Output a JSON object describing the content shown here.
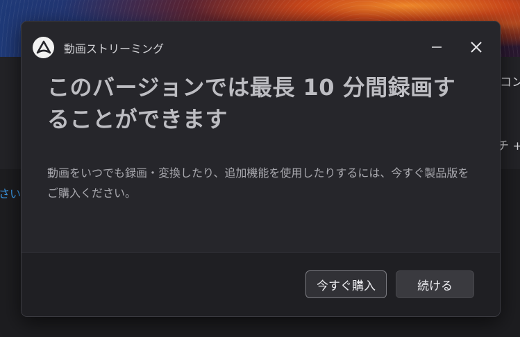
{
  "background": {
    "side_text_1": "コンテ",
    "side_text_2": "チ +",
    "link_text": "さい。"
  },
  "dialog": {
    "app_name": "動画ストリーミング",
    "logo_icon": "app-logo-icon",
    "minimize_icon": "minimize-icon",
    "close_icon": "close-icon",
    "headline": "このバージョンでは最長 10 分間録画することができます",
    "description": "動画をいつでも録画・変換したり、追加機能を使用したりするには、今すぐ製品版をご購入ください。",
    "buttons": {
      "buy_label": "今すぐ購入",
      "continue_label": "続ける"
    }
  },
  "colors": {
    "dialog_bg": "#26262b",
    "footer_bg": "#1f1f23",
    "link": "#3b9ae8"
  }
}
